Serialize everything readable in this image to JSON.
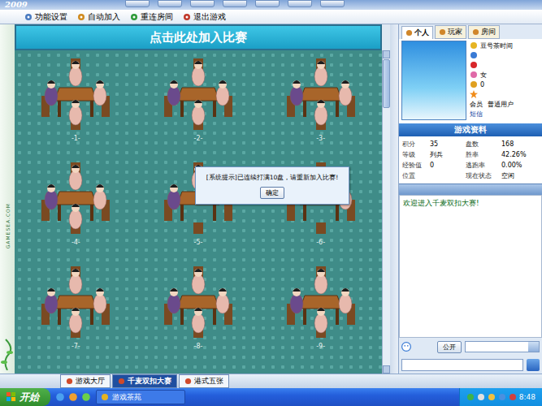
{
  "app": {
    "logo": "2009"
  },
  "menu": [
    {
      "icon": "gear",
      "label": "功能设置"
    },
    {
      "icon": "auto",
      "label": "自动加入"
    },
    {
      "icon": "reconnect",
      "label": "重连房间"
    },
    {
      "icon": "exit",
      "label": "退出游戏"
    }
  ],
  "watermark": "GAMESEA.COM",
  "banner": "点击此处加入比赛",
  "tables": [
    {
      "number": "-1-",
      "seats": [
        true,
        true,
        true,
        true
      ]
    },
    {
      "number": "-2-",
      "seats": [
        true,
        true,
        true,
        true
      ]
    },
    {
      "number": "-3-",
      "seats": [
        true,
        true,
        true,
        true
      ]
    },
    {
      "number": "-4-",
      "seats": [
        true,
        true,
        true,
        true
      ]
    },
    {
      "number": "-5-",
      "seats": [
        true,
        false,
        false,
        true
      ]
    },
    {
      "number": "-6-",
      "seats": [
        false,
        true,
        false,
        false
      ]
    },
    {
      "number": "-7-",
      "seats": [
        true,
        true,
        true,
        true
      ]
    },
    {
      "number": "-8-",
      "seats": [
        true,
        true,
        true,
        true
      ]
    },
    {
      "number": "-9-",
      "seats": [
        true,
        true,
        true,
        true
      ]
    }
  ],
  "dialog": {
    "message": "[系统提示]已连续打满10盘，请重新加入比赛!",
    "button": "确定"
  },
  "side_tabs": [
    {
      "label": "个人",
      "selected": true
    },
    {
      "label": "玩家",
      "selected": false
    },
    {
      "label": "房间",
      "selected": false
    }
  ],
  "profile": {
    "items": [
      {
        "kind": "coin",
        "label": "豆号茶时间"
      },
      {
        "kind": "id",
        "label": ""
      },
      {
        "kind": "heart",
        "label": ""
      },
      {
        "kind": "gender",
        "label": "女"
      },
      {
        "kind": "medal",
        "label": "0"
      },
      {
        "kind": "star",
        "label": ""
      }
    ],
    "member_label": "会员",
    "member_value": "普通用户",
    "message": "短信"
  },
  "stats": {
    "title": "游戏资料",
    "rows": [
      {
        "label": "积分",
        "value": "35"
      },
      {
        "label": "盘数",
        "value": "168"
      },
      {
        "label": "等级",
        "value": "列兵"
      },
      {
        "label": "胜率",
        "value": "42.26%"
      },
      {
        "label": "经验值",
        "value": "0"
      },
      {
        "label": "逃跑率",
        "value": "0.00%"
      },
      {
        "label": "位置",
        "value": ""
      },
      {
        "label": "现在状态",
        "value": "空闲"
      }
    ]
  },
  "chat": {
    "messages": [
      "欢迎进入千麦双扣大赛!"
    ],
    "mode_button": "公开",
    "input": ""
  },
  "bottom_tabs": [
    {
      "label": "游戏大厅",
      "selected": false
    },
    {
      "label": "千麦双扣大赛",
      "selected": true
    },
    {
      "label": "港式五张",
      "selected": false
    }
  ],
  "taskbar": {
    "start": "开始",
    "tasks": [
      {
        "label": "游戏茶苑",
        "selected": false
      }
    ],
    "clock": "8:48"
  }
}
